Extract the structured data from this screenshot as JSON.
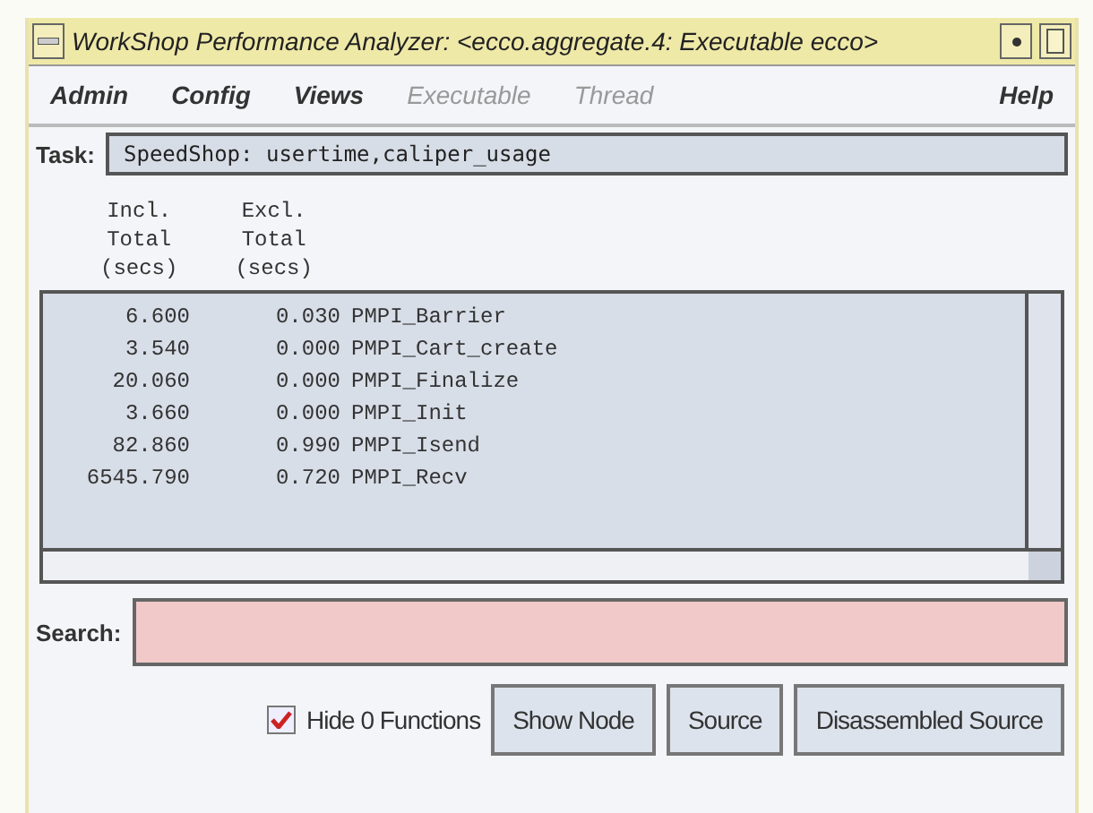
{
  "window": {
    "title": "WorkShop Performance Analyzer: <ecco.aggregate.4: Executable ecco>"
  },
  "menu": [
    {
      "label": "Admin",
      "disabled": false
    },
    {
      "label": "Config",
      "disabled": false
    },
    {
      "label": "Views",
      "disabled": false
    },
    {
      "label": "Executable",
      "disabled": true
    },
    {
      "label": "Thread",
      "disabled": true
    },
    {
      "label": "Help",
      "disabled": false
    }
  ],
  "task": {
    "label": "Task:",
    "value": "SpeedShop: usertime,caliper_usage"
  },
  "table": {
    "columns": [
      [
        "Incl.",
        "Total",
        "(secs)"
      ],
      [
        "Excl.",
        "Total",
        "(secs)"
      ]
    ],
    "rows": [
      {
        "incl": "6.600",
        "excl": "0.030",
        "name": "PMPI_Barrier"
      },
      {
        "incl": "3.540",
        "excl": "0.000",
        "name": "PMPI_Cart_create"
      },
      {
        "incl": "20.060",
        "excl": "0.000",
        "name": "PMPI_Finalize"
      },
      {
        "incl": "3.660",
        "excl": "0.000",
        "name": "PMPI_Init"
      },
      {
        "incl": "82.860",
        "excl": "0.990",
        "name": "PMPI_Isend"
      },
      {
        "incl": "6545.790",
        "excl": "0.720",
        "name": "PMPI_Recv"
      }
    ]
  },
  "search": {
    "label": "Search:"
  },
  "hide_zero": {
    "label": "Hide 0 Functions",
    "checked": true
  },
  "buttons": [
    "Show Node",
    "Source",
    "Disassembled Source"
  ]
}
